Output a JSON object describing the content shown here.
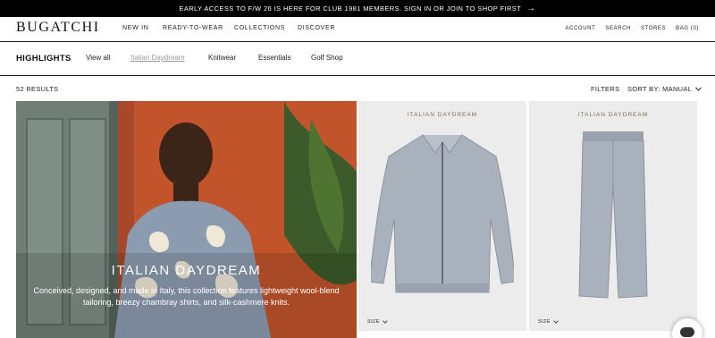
{
  "announcement": {
    "text": "EARLY ACCESS TO F/W 26 IS HERE FOR CLUB 1981 MEMBERS. SIGN IN OR JOIN TO SHOP FIRST",
    "arrow": "→"
  },
  "brand": {
    "logo": "BUGATCHI"
  },
  "main_nav": [
    "NEW IN",
    "READY-TO-WEAR",
    "COLLECTIONS",
    "DISCOVER"
  ],
  "util_nav": [
    "ACCOUNT",
    "SEARCH",
    "STORES",
    "BAG (0)"
  ],
  "subnav": {
    "title": "HIGHLIGHTS",
    "items": [
      {
        "label": "View all",
        "active": false
      },
      {
        "label": "Italian Daydream",
        "active": true
      },
      {
        "label": "Knitwear",
        "active": false
      },
      {
        "label": "Essentials",
        "active": false
      },
      {
        "label": "Golf Shop",
        "active": false
      }
    ]
  },
  "listing": {
    "results": "52 RESULTS",
    "filters": "FILTERS",
    "sort": "SORT BY: MANUAL"
  },
  "hero": {
    "title": "ITALIAN DAYDREAM",
    "subtitle": "Conceived, designed, and made in Italy, this collection features lightweight wool-blend tailoring, breezy chambray shirts, and silk-cashmere knits."
  },
  "products": [
    {
      "tag": "ITALIAN DAYDREAM",
      "size_label": "SIZE",
      "kind": "jacket",
      "color": "#a9b1bd"
    },
    {
      "tag": "ITALIAN DAYDREAM",
      "size_label": "SIZE",
      "kind": "trousers",
      "color": "#a9b1bd"
    }
  ],
  "colors": {
    "accent_tag": "#7a6a52",
    "hero_wall": "#c2542b",
    "hero_door": "#6f7f77"
  }
}
